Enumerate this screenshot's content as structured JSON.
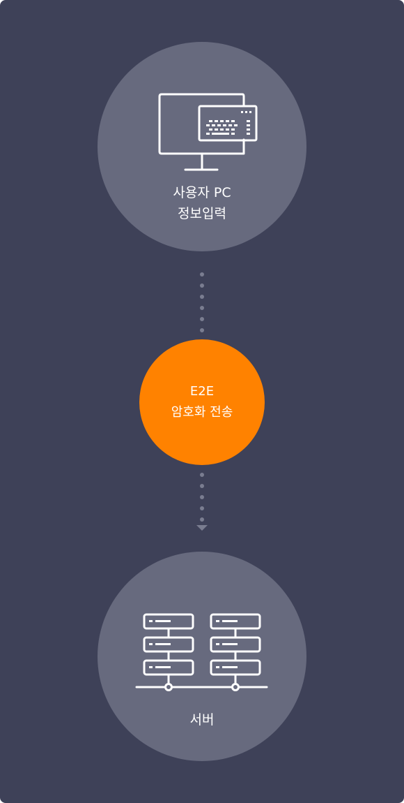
{
  "colors": {
    "background": "#3e4158",
    "node": "#676a7e",
    "accent": "#ff8200",
    "dots": "#7a7d90"
  },
  "nodes": {
    "client": {
      "icon": "monitor-keyboard-icon",
      "line1": "사용자 PC",
      "line2": "정보입력"
    },
    "transfer": {
      "line1": "E2E",
      "line2": "암호화 전송"
    },
    "server": {
      "icon": "server-rack-icon",
      "line1": "서버"
    }
  }
}
